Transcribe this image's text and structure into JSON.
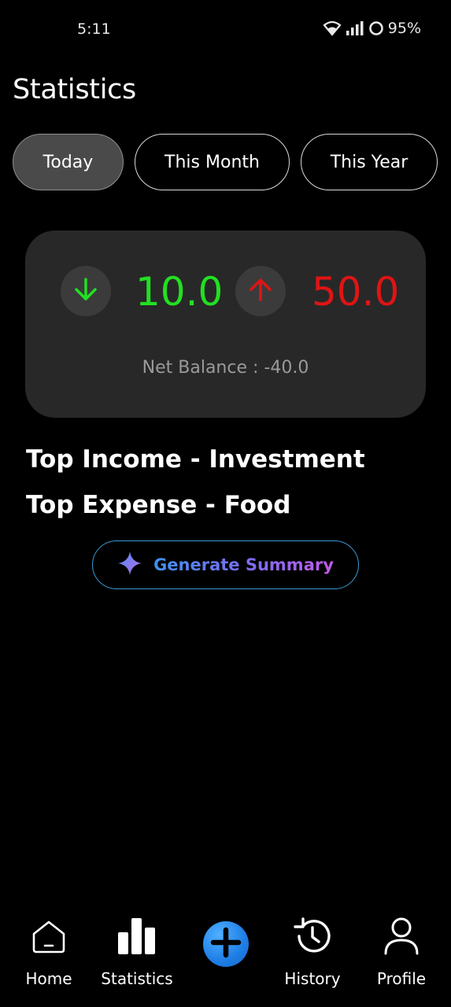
{
  "status_bar": {
    "time": "5:11",
    "battery": "95%"
  },
  "page": {
    "title": "Statistics"
  },
  "tabs": [
    {
      "label": "Today",
      "active": true
    },
    {
      "label": "This Month",
      "active": false
    },
    {
      "label": "This Year",
      "active": false
    }
  ],
  "summary": {
    "income": "10.0",
    "expense": "50.0",
    "net_balance": "Net Balance : -40.0",
    "income_color": "#22e022",
    "expense_color": "#e01414"
  },
  "tops": {
    "income": "Top Income - Investment",
    "expense": "Top Expense - Food"
  },
  "generate": {
    "label": "Generate Summary"
  },
  "nav": {
    "home": "Home",
    "statistics": "Statistics",
    "history": "History",
    "profile": "Profile"
  }
}
